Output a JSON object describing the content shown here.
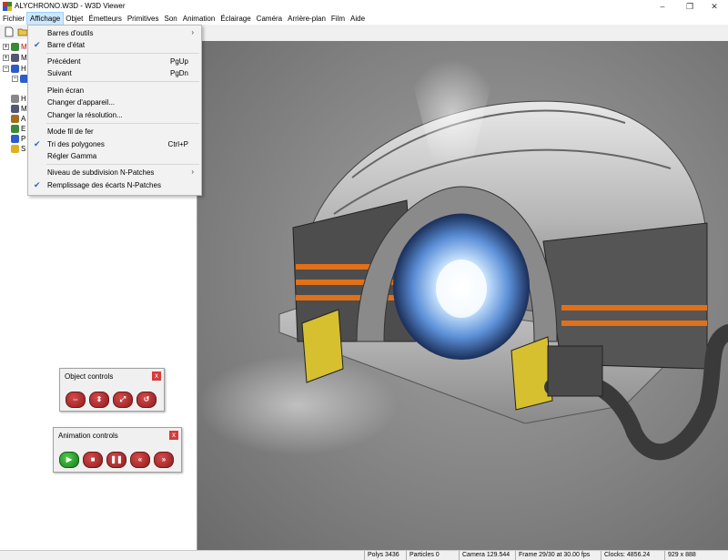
{
  "window": {
    "title": "ALYCHRONO.W3D - W3D Viewer",
    "minimize_glyph": "–",
    "restore_glyph": "❐",
    "close_glyph": "✕"
  },
  "menubar": [
    {
      "label": "Fichier"
    },
    {
      "label": "Affichage"
    },
    {
      "label": "Objet"
    },
    {
      "label": "Émetteurs"
    },
    {
      "label": "Primitives"
    },
    {
      "label": "Son"
    },
    {
      "label": "Animation"
    },
    {
      "label": "Éclairage"
    },
    {
      "label": "Caméra"
    },
    {
      "label": "Arrière-plan"
    },
    {
      "label": "Film"
    },
    {
      "label": "Aide"
    }
  ],
  "view_menu": {
    "items": [
      {
        "label": "Barres d'outils",
        "shortcut": "",
        "checked": false,
        "submenu": true
      },
      {
        "label": "Barre d'état",
        "shortcut": "",
        "checked": true,
        "submenu": false
      },
      {
        "label": "Précédent",
        "shortcut": "PgUp",
        "checked": false,
        "submenu": false
      },
      {
        "label": "Suivant",
        "shortcut": "PgDn",
        "checked": false,
        "submenu": false
      },
      {
        "label": "Plein écran",
        "shortcut": "",
        "checked": false,
        "submenu": false
      },
      {
        "label": "Changer d'appareil...",
        "shortcut": "",
        "checked": false,
        "submenu": false
      },
      {
        "label": "Changer la résolution...",
        "shortcut": "",
        "checked": false,
        "submenu": false
      },
      {
        "label": "Mode fil de fer",
        "shortcut": "",
        "checked": false,
        "submenu": false
      },
      {
        "label": "Tri des polygones",
        "shortcut": "Ctrl+P",
        "checked": true,
        "submenu": false
      },
      {
        "label": "Régler Gamma",
        "shortcut": "",
        "checked": false,
        "submenu": false
      },
      {
        "label": "Niveau de subdivision N-Patches",
        "shortcut": "",
        "checked": false,
        "submenu": true
      },
      {
        "label": "Remplissage des écarts N-Patches",
        "shortcut": "",
        "checked": true,
        "submenu": false
      }
    ],
    "check_glyph": "✔",
    "submenu_glyph": "›"
  },
  "object_controls": {
    "title": "Object controls",
    "close_glyph": "x",
    "buttons": [
      {
        "icon": "rotate-x-icon",
        "glyph": "⇔"
      },
      {
        "icon": "rotate-y-icon",
        "glyph": "⇕"
      },
      {
        "icon": "rotate-z-icon",
        "glyph": "⤢"
      },
      {
        "icon": "reset-rotation-icon",
        "glyph": "↺"
      }
    ]
  },
  "animation_controls": {
    "title": "Animation controls",
    "close_glyph": "x",
    "buttons": [
      {
        "icon": "play-icon",
        "glyph": "▶"
      },
      {
        "icon": "stop-icon",
        "glyph": "■"
      },
      {
        "icon": "pause-icon",
        "glyph": "❚❚"
      },
      {
        "icon": "step-back-icon",
        "glyph": "«"
      },
      {
        "icon": "step-forward-icon",
        "glyph": "»"
      }
    ]
  },
  "tree": {
    "partial_labels": [
      "M",
      "M",
      "H",
      "H",
      "M",
      "A",
      "E",
      "P",
      "S"
    ]
  },
  "statusbar": {
    "polys": "Polys 3436",
    "particles": "Particles 0",
    "camera": "Camera 129.544",
    "frame": "Frame 29/30 at 30.00 fps",
    "clocks": "Clocks: 4856.24",
    "resolution": "929 x 888"
  },
  "colors": {
    "menu_highlight": "#cce8ff",
    "check_blue": "#2a64b8",
    "panel_close_red": "#d63b3b",
    "button_red": "#b82a2a",
    "button_green": "#2aa52a"
  }
}
